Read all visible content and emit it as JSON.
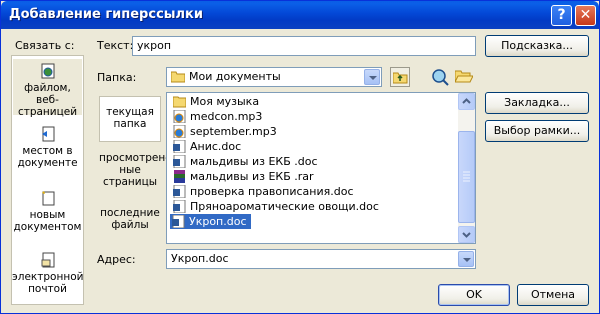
{
  "window": {
    "title": "Добавление гиперссылки",
    "help_glyph": "?",
    "close_glyph": "✕"
  },
  "link_to": {
    "label": "Связать с:",
    "items": [
      {
        "label": "файлом, веб-страницей",
        "icon": "web-page-icon",
        "selected": true
      },
      {
        "label": "местом в документе",
        "icon": "document-place-icon",
        "selected": false
      },
      {
        "label": "новым документом",
        "icon": "new-document-icon",
        "selected": false
      },
      {
        "label": "электронной почтой",
        "icon": "email-icon",
        "selected": false
      }
    ]
  },
  "text_field": {
    "label": "Текст:",
    "value": "укроп"
  },
  "tooltip_button": {
    "label": "Подсказка..."
  },
  "folder": {
    "label": "Папка:",
    "value": "Мои документы",
    "icon": "folder-icon"
  },
  "toolbar_icons": [
    "up-folder-icon",
    "web-search-icon",
    "open-folder-icon"
  ],
  "places": [
    {
      "label": "текущая папка",
      "selected": true
    },
    {
      "label": "просмотрен-ные страницы",
      "selected": false
    },
    {
      "label": "последние файлы",
      "selected": false
    }
  ],
  "files": [
    {
      "name": "Моя музыка",
      "icon": "music-folder-icon",
      "selected": false
    },
    {
      "name": "medcon.mp3",
      "icon": "media-icon",
      "selected": false
    },
    {
      "name": "september.mp3",
      "icon": "media-icon",
      "selected": false
    },
    {
      "name": "Анис.doc",
      "icon": "word-doc-icon",
      "selected": false
    },
    {
      "name": "мальдивы из ЕКБ .doc",
      "icon": "word-doc-icon",
      "selected": false
    },
    {
      "name": "мальдивы из ЕКБ .rar",
      "icon": "rar-archive-icon",
      "selected": false
    },
    {
      "name": "проверка правописания.doc",
      "icon": "word-doc-icon",
      "selected": false
    },
    {
      "name": "Пряноароматические овощи.doc",
      "icon": "word-doc-icon",
      "selected": false
    },
    {
      "name": "Укроп.doc",
      "icon": "word-doc-icon",
      "selected": true
    }
  ],
  "bookmark_button": {
    "label": "Закладка..."
  },
  "frame_button": {
    "label": "Выбор рамки..."
  },
  "address": {
    "label": "Адрес:",
    "value": "Укроп.doc"
  },
  "ok_button": {
    "label": "OK"
  },
  "cancel_button": {
    "label": "Отмена"
  },
  "colors": {
    "titlebar": "#0347d6",
    "dialog_bg": "#ece9d8",
    "selection": "#316ac5"
  }
}
